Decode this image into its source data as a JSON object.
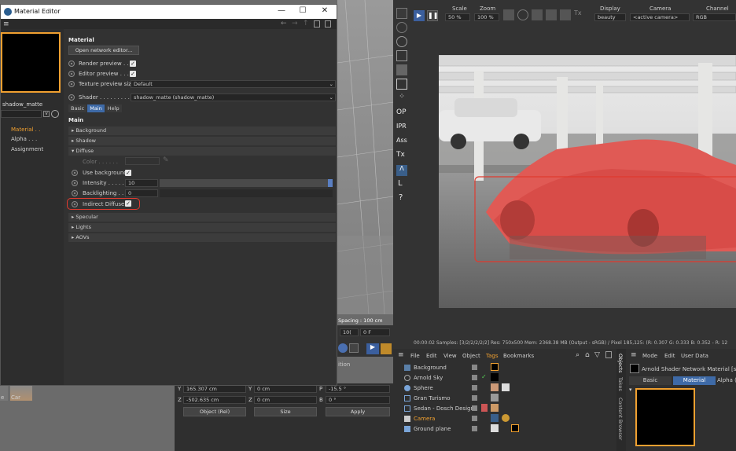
{
  "material_editor": {
    "title": "Material Editor",
    "minimize": "—",
    "maximize": "☐",
    "close": "✕",
    "material_name": "shadow_matte",
    "channels": [
      "Material . .",
      "Alpha . . .",
      "Assignment"
    ],
    "section_title": "Material",
    "open_editor": "Open network editor...",
    "render_preview": "Render preview . . .",
    "editor_preview": "Editor preview . . .",
    "texture_preview_size": "Texture preview size",
    "texture_preview_value": "Default",
    "shader_label": "Shader . . . . . . . . .",
    "shader_value": "shadow_matte (shadow_matte)",
    "tabs": [
      "Basic",
      "Main",
      "Help"
    ],
    "main_title": "Main",
    "groups": [
      "Background",
      "Shadow",
      "Diffuse"
    ],
    "diffuse": {
      "color_label": "Color . . . . . .",
      "use_background": "Use background",
      "intensity_label": "Intensity . . . . . .",
      "intensity_value": "10",
      "backlighting_label": "Backlighting . . .",
      "backlighting_value": "0",
      "indirect_diffuse": "Indirect Diffuse"
    },
    "groups_after": [
      "Specular",
      "Lights",
      "AOVs"
    ]
  },
  "viewport_left": {
    "grid_spacing": "Spacing : 100 cm",
    "frame_value": "0 F",
    "frame_end": "10(",
    "section_label": "ition",
    "thumb_labels": [
      "e",
      "Car"
    ],
    "coords": {
      "y_label": "Y",
      "y_value": "165.307 cm",
      "y2_label": "Y",
      "y2_value": "0 cm",
      "p_label": "P",
      "p_value": "-15.5 °",
      "z_label": "Z",
      "z_value": "-502.635 cm",
      "z2_label": "Z",
      "z2_value": "0 cm",
      "b_label": "B",
      "b_value": "0 °",
      "mode": "Object (Rel)",
      "size": "Size",
      "apply": "Apply"
    }
  },
  "ipr": {
    "scale_label": "Scale",
    "scale_value": "50 %",
    "zoom_label": "Zoom",
    "zoom_value": "100 %",
    "display_label": "Display",
    "display_value": "beauty",
    "camera_label": "Camera",
    "camera_value": "<active camera>",
    "channel_label": "Channel",
    "channel_value": "RGB",
    "tool_labels": [
      "OP",
      "IPR",
      "Ass",
      "Tx",
      "L",
      "?"
    ],
    "status": "00:00:02  Samples: [3/2/2/2/2/2]  Res: 750x500  Mem: 2368.38 MB  (Output - sRGB) / Pixel 185,125: (R: 0.307 G: 0.333 B: 0.352 - R: 12"
  },
  "object_manager": {
    "menu": [
      "File",
      "Edit",
      "View",
      "Object",
      "Tags",
      "Bookmarks"
    ],
    "active_menu": "Tags",
    "objects": [
      "Background",
      "Arnold Sky",
      "Sphere",
      "Gran Turismo",
      "Sedan - Dosch Design",
      "Camera",
      "Ground plane"
    ],
    "side_tabs": [
      "Objects",
      "Takes",
      "Content Browser"
    ]
  },
  "attributes": {
    "menu": [
      "Mode",
      "Edit",
      "User Data"
    ],
    "title": "Arnold Shader Network Material [shad",
    "tabs": [
      "Basic",
      "Material",
      "Alpha (c"
    ]
  },
  "colors": {
    "accent": "#3e6aa7",
    "highlight_red": "#e03a2f",
    "selection_orange": "#f0a030"
  }
}
